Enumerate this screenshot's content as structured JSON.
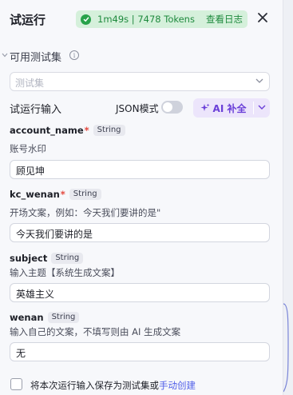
{
  "header": {
    "title": "试运行",
    "status_text": "1m49s | 7478 Tokens",
    "view_log_label": "查看日志",
    "status_color": "#27a24a"
  },
  "testset": {
    "section_label": "可用测试集",
    "select_placeholder": "测试集"
  },
  "run_input": {
    "label": "试运行输入",
    "json_mode_label": "JSON模式",
    "json_mode_on": false,
    "ai_fill_label": "AI 补全",
    "accent": "#6a3fd8"
  },
  "fields": [
    {
      "name": "account_name",
      "required": true,
      "type": "String",
      "description": "账号水印",
      "value": "顾见坤"
    },
    {
      "name": "kc_wenan",
      "required": true,
      "type": "String",
      "description": "开场文案，例如：今天我们要讲的是\"",
      "value": "今天我们要讲的是"
    },
    {
      "name": "subject",
      "required": false,
      "type": "String",
      "description": "输入主题【系统生成文案】",
      "value": "英雄主义"
    },
    {
      "name": "wenan",
      "required": false,
      "type": "String",
      "description": "输入自己的文案，不填写则由 AI 生成文案",
      "value": "无"
    }
  ],
  "footer": {
    "save_text": "将本次运行输入保存为测试集或",
    "manual_create_link": "手动创建",
    "checked": false
  }
}
